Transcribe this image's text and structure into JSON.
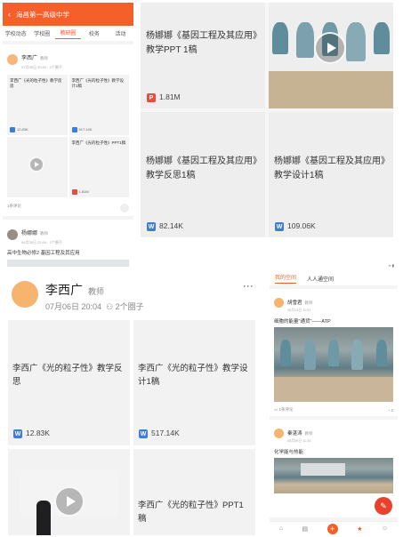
{
  "panel_a": {
    "header_title": "海昌第一高级中学",
    "tabs": [
      {
        "label": "学校动态",
        "active": false
      },
      {
        "label": "学校圈",
        "active": false
      },
      {
        "label": "教研圈",
        "active": true
      },
      {
        "label": "校务",
        "active": false
      },
      {
        "label": "活动",
        "active": false
      }
    ],
    "post1": {
      "author": "李西广",
      "role": "教师",
      "meta": "07月06日 20:04",
      "circles": "2个圈子",
      "items": [
        {
          "title": "李西广《光的粒子性》教学反思",
          "size": "12.83K",
          "type": "W"
        },
        {
          "title": "李西广《光的粒子性》教学设计1稿",
          "size": "517.14K",
          "type": "W"
        },
        {
          "title": "",
          "size": "",
          "type": "video"
        },
        {
          "title": "李西广《光的粒子性》PPT1稿",
          "size": "1.81M",
          "type": "P"
        }
      ],
      "comments": "1条评论"
    },
    "post2": {
      "author": "杨娜娜",
      "role": "教师",
      "meta": "06月28日 22:04",
      "circles": "2个圈子",
      "content": "高中生物必修2 基因工程及其应用"
    }
  },
  "panel_b": {
    "items": [
      {
        "title": "杨娜娜《基因工程及其应用》教学PPT 1稿",
        "size": "1.81M",
        "type": "P"
      },
      {
        "title": "",
        "size": "",
        "type": "video"
      },
      {
        "title": "杨娜娜《基因工程及其应用》教学反思1稿",
        "size": "82.14K",
        "type": "W"
      },
      {
        "title": "杨娜娜《基因工程及其应用》教学设计1稿",
        "size": "109.06K",
        "type": "W"
      }
    ]
  },
  "panel_c": {
    "author": "李西广",
    "role": "教师",
    "date": "07月06日 20:04",
    "circles": "2个圈子",
    "items": [
      {
        "title": "李西广《光的粒子性》教学反思",
        "size": "12.83K",
        "type": "W"
      },
      {
        "title": "李西广《光的粒子性》教学设计1稿",
        "size": "517.14K",
        "type": "W"
      },
      {
        "title": "",
        "size": "",
        "type": "video"
      },
      {
        "title": "李西广《光的粒子性》PPT1稿",
        "size": "",
        "type": "P"
      }
    ]
  },
  "panel_d": {
    "tabs": [
      {
        "label": "我的空间",
        "active": true
      },
      {
        "label": "人人通空间",
        "active": false
      }
    ],
    "post1": {
      "author": "胡雪君",
      "role": "教师",
      "meta": "06月13日 11:51",
      "content": "细胞的能量\"通货\"——ATP",
      "comments": "1条评论",
      "likes": "2"
    },
    "post2": {
      "author": "秦湛涛",
      "role": "教师",
      "meta": "06月09日 11:33",
      "content": "化学能与热能"
    }
  },
  "colors": {
    "accent": "#f5602a",
    "word_badge": "#3b7ddd",
    "ppt_badge": "#e94c3d",
    "fab": "#e8412c"
  },
  "icons": {
    "back": "‹",
    "more": "⋮",
    "plus": "+",
    "edit": "✎"
  }
}
